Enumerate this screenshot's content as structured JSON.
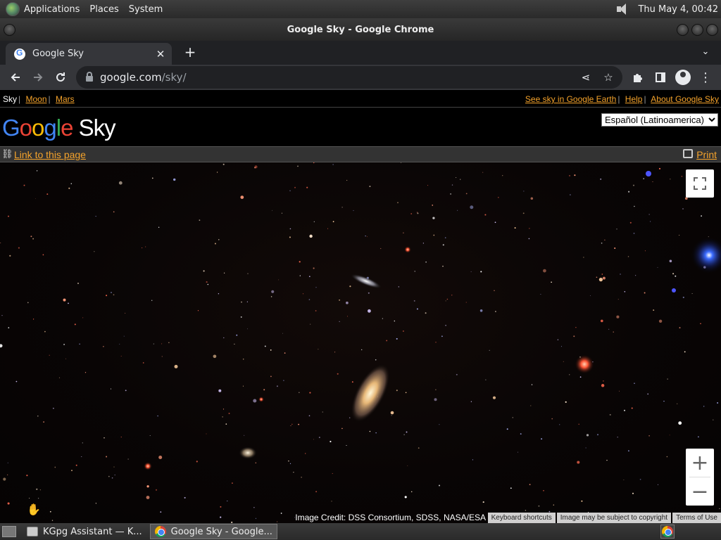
{
  "panel": {
    "menus": [
      "Applications",
      "Places",
      "System"
    ],
    "clock": "Thu May  4, 00:42"
  },
  "window": {
    "title": "Google Sky - Google Chrome"
  },
  "tab": {
    "title": "Google Sky",
    "close": "✕",
    "newtab": "+"
  },
  "omnibox": {
    "host": "google.com",
    "path": "/sky/"
  },
  "gbar": {
    "current": "Sky",
    "left_links": [
      "Moon",
      "Mars"
    ],
    "right_links": [
      "See sky in Google Earth",
      "Help",
      "About Google Sky"
    ],
    "separator": "|"
  },
  "logo": {
    "letters": [
      "G",
      "o",
      "o",
      "g",
      "l",
      "e"
    ],
    "product": " Sky"
  },
  "language": {
    "selected": "Español (Latinoamerica)"
  },
  "linkbar": {
    "link_label": "Link to this page",
    "print_label": "Print"
  },
  "map": {
    "credit": "Image Credit: DSS Consortium, SDSS, NASA/ESA",
    "footer": [
      "Keyboard shortcuts",
      "Image may be subject to copyright",
      "Terms of Use"
    ],
    "zoom_in": "+",
    "zoom_out": "−"
  },
  "taskbar": {
    "tasks": [
      "KGpg Assistant — K...",
      "Google Sky - Google..."
    ]
  },
  "colors": {
    "link": "#f5a32b",
    "logo_blue": "#4285f4",
    "logo_red": "#ea4335",
    "logo_yellow": "#fbbc05",
    "logo_green": "#34a853"
  }
}
